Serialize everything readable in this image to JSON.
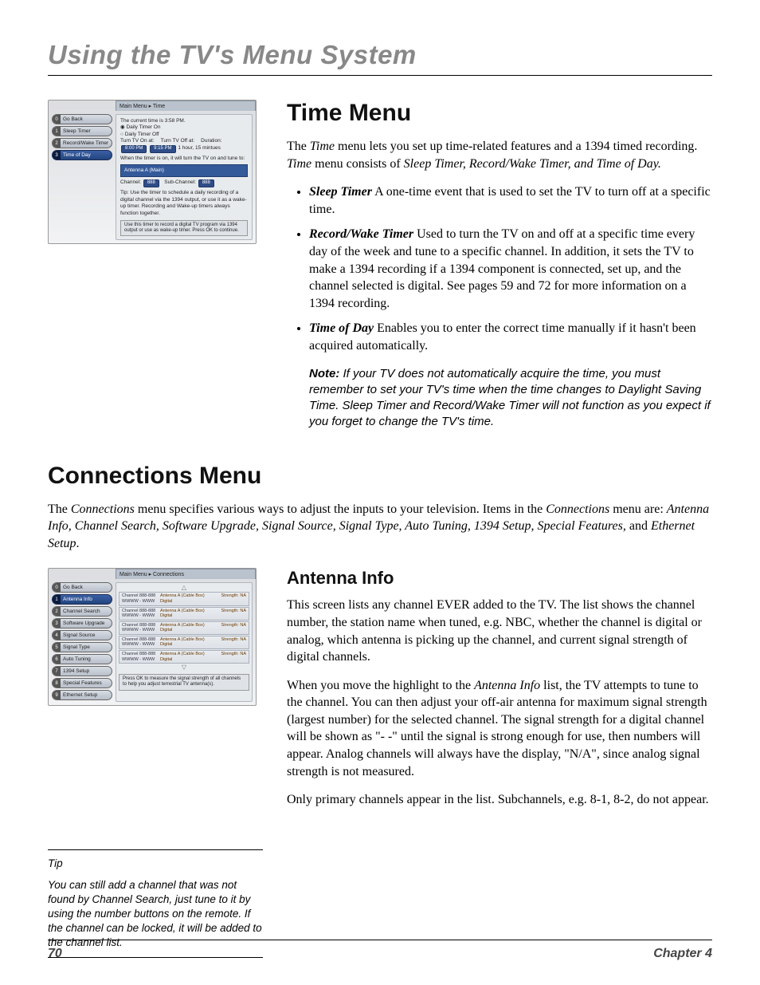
{
  "page_title": "Using the TV's Menu System",
  "footer": {
    "page_num": "70",
    "chapter": "Chapter 4"
  },
  "time_menu": {
    "heading": "Time Menu",
    "intro_pre": "The ",
    "intro_term1": "Time",
    "intro_mid1": " menu lets you set up time-related features and a 1394 timed recording. ",
    "intro_term2": "Time",
    "intro_mid2": " menu consists of ",
    "intro_term3": "Sleep Timer, Record/Wake Timer, and Time of Day.",
    "bullets": [
      {
        "term": "Sleep Timer",
        "body": "   A one-time event that is used to set the TV to turn off at a specific time."
      },
      {
        "term": "Record/Wake Timer",
        "body": "   Used to turn the TV on and off at a specific time every day of the week and tune to a specific channel. In addition, it sets the TV to make a 1394 recording if a 1394 component is connected, set up, and the channel selected is digital. See pages 59 and 72 for more information on a 1394 recording."
      },
      {
        "term": "Time of Day",
        "body": "   Enables you to enter the correct time manually if it hasn't been acquired automatically."
      }
    ],
    "note_label": "Note:",
    "note_body": " If your TV does not automatically acquire the time, you must remember to set your TV's time when the time changes to Daylight Saving Time. Sleep Timer and Record/Wake Timer will not function as you expect if you forget to change the TV's time."
  },
  "connections_menu": {
    "heading": "Connections Menu",
    "intro_pre": "The ",
    "intro_term1": "Connections",
    "intro_mid1": " menu specifies various ways to adjust the inputs to your television. Items in the ",
    "intro_term2": "Connections",
    "intro_mid2": " menu are: ",
    "intro_term3": "Antenna Info, Channel Search, Software Upgrade, Signal Source, Signal Type, Auto Tuning, 1394 Setup, Special Features,",
    "intro_mid3": " and ",
    "intro_term4": "Ethernet Setup",
    "intro_end": "."
  },
  "antenna_info": {
    "heading": "Antenna Info",
    "p1": "This screen lists any channel EVER added to the TV. The list shows the channel number, the station name when tuned, e.g. NBC, whether the channel is digital or analog, which antenna is picking up the channel, and current signal strength of digital channels.",
    "p2_pre": "When you move the highlight to the ",
    "p2_term": "Antenna Info",
    "p2_post": " list, the TV attempts to tune to the channel. You can then adjust your off-air antenna for maximum signal strength (largest number) for the selected channel. The signal strength for a digital channel will be shown as \"- -\" until the signal is strong enough for use, then numbers will appear. Analog channels will always have the display, \"N/A\", since analog signal strength is not measured.",
    "p3": "Only primary channels appear in the list. Subchannels, e.g. 8-1, 8-2, do not appear."
  },
  "tip": {
    "title": "Tip",
    "body": "You can still add a channel that was not found by Channel Search, just tune to it by using the number buttons on the remote. If the channel can be locked, it will be added to the channel list."
  },
  "tv_time": {
    "breadcrumb": "Main Menu ▸ Time",
    "sidebar": [
      {
        "n": "0",
        "label": "Go Back"
      },
      {
        "n": "1",
        "label": "Sleep Timer"
      },
      {
        "n": "2",
        "label": "Record/Wake Timer"
      },
      {
        "n": "3",
        "label": "Time of Day"
      }
    ],
    "current_time": "The current time is 3:58 PM.",
    "opt_on": "Daily Timer On",
    "opt_off": "Daily Timer Off",
    "row_labels": {
      "on": "Turn TV On at:",
      "off": "Turn TV Off at:",
      "dur": "Duration:"
    },
    "val_on": "8:00 PM",
    "val_off": "9:15 PM",
    "duration": "1 hour, 15 mintues",
    "tune_msg": "When the timer is on, it will turn the TV on and tune to:",
    "ant_label": "Antenna A (Main)",
    "chan_pre": "Channel:",
    "chan_val": "888",
    "sub_pre": "Sub-Channel:",
    "sub_val": "888",
    "tip": "Tip: Use the timer to schedule a daily recording  of a digital channel via the 1394 output, or use it as a wake-up timer. Recording and Wake-up timers always function together.",
    "help": "Use this timer to record a digital TV program via 1394 output or use as wake-up timer. Press OK to continue."
  },
  "tv_conn": {
    "breadcrumb": "Main Menu ▸ Connections",
    "sidebar": [
      {
        "n": "0",
        "label": "Go Back"
      },
      {
        "n": "1",
        "label": "Antenna Info"
      },
      {
        "n": "2",
        "label": "Channel Search"
      },
      {
        "n": "3",
        "label": "Software Upgrade"
      },
      {
        "n": "4",
        "label": "Signal Source"
      },
      {
        "n": "5",
        "label": "Signal Type"
      },
      {
        "n": "6",
        "label": "Auto Tuning"
      },
      {
        "n": "7",
        "label": "1394 Setup"
      },
      {
        "n": "8",
        "label": "Special Features"
      },
      {
        "n": "9",
        "label": "Ethernet Setup"
      }
    ],
    "row": {
      "ch": "Channel 888-888",
      "ww": "WWWW - WWW",
      "ant": "Antenna A (Cable Box)",
      "dig": "Digital",
      "str": "Strength: NA"
    },
    "help": "Press OK to measure the signal strength of all channels to help you adjust terrestrial TV antenna(s)."
  }
}
